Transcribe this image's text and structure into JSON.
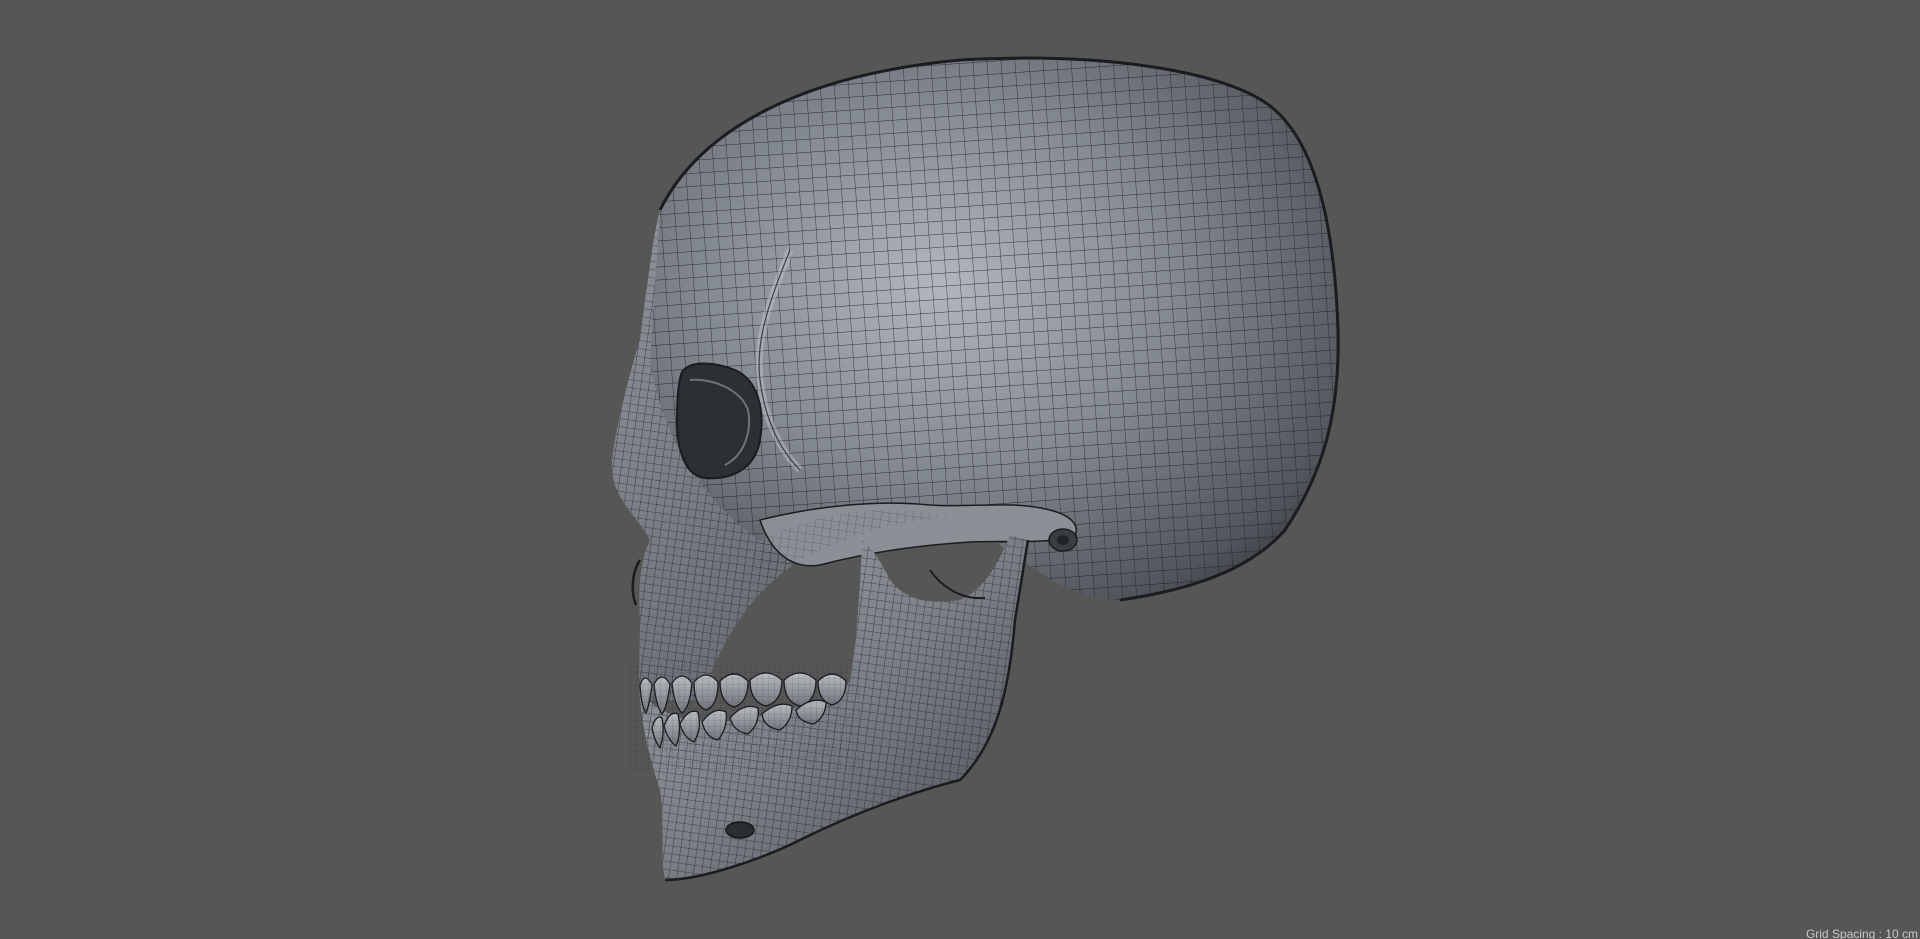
{
  "viewport": {
    "background_color": "#565656",
    "mesh_color": "#1c1f24",
    "model_fill_color": "#7a7f86",
    "model_highlight_color": "#aeb3b9",
    "model_shadow_color": "#3a3d42",
    "model": "skull-wireframe",
    "view": "left-side"
  },
  "status": {
    "grid_spacing_label": "Grid Spacing",
    "grid_spacing_value": "10 cm",
    "grid_spacing_text": "Grid Spacing : 10 cm"
  }
}
